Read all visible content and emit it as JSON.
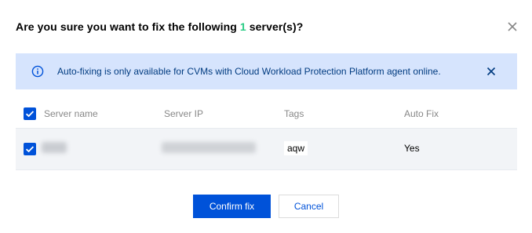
{
  "dialog": {
    "title_prefix": "Are you sure you want to fix the following ",
    "title_count": "1",
    "title_suffix": " server(s)?",
    "close_icon": "close-icon"
  },
  "notice": {
    "icon": "info-circle-icon",
    "text": "Auto-fixing is only available for CVMs with Cloud Workload Protection Platform agent online.",
    "close_icon": "close-icon"
  },
  "table": {
    "columns": [
      "Server name",
      "Server IP",
      "Tags",
      "Auto Fix"
    ],
    "rows": [
      {
        "checked": true,
        "tag": "aqw",
        "auto_fix": "Yes"
      }
    ],
    "select_all_checked": true
  },
  "buttons": {
    "confirm": "Confirm fix",
    "cancel": "Cancel"
  },
  "colors": {
    "accent": "#0052d9",
    "count": "#29cc85",
    "notice_bg": "#d6e4fd",
    "notice_text": "#003b80"
  }
}
